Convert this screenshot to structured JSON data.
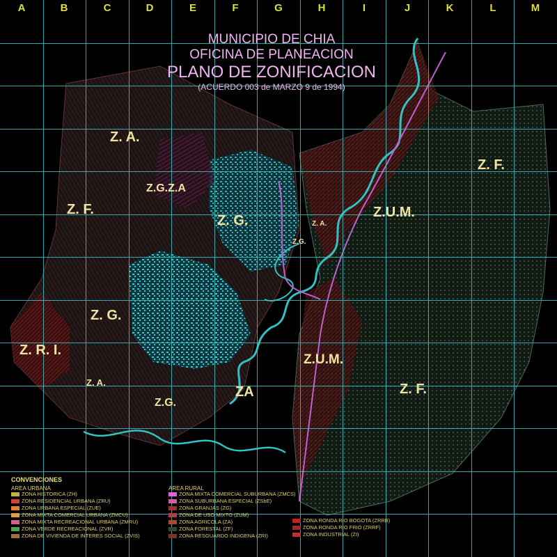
{
  "grid_columns": [
    "A",
    "B",
    "C",
    "D",
    "E",
    "F",
    "G",
    "H",
    "I",
    "J",
    "K",
    "L",
    "M"
  ],
  "title": {
    "line1": "MUNICIPIO DE CHIA",
    "line2": "OFICINA DE PLANEACION",
    "line3": "PLANO DE ZONIFICACION",
    "line4": "(ACUERDO 003 de MARZO 9 de 1994)"
  },
  "zone_labels": [
    {
      "key": "za_top",
      "text": "Z. A."
    },
    {
      "key": "zf_left",
      "text": "Z. F."
    },
    {
      "key": "zgza",
      "text": "Z.G.Z.A"
    },
    {
      "key": "zg_center",
      "text": "Z. G."
    },
    {
      "key": "zg_left",
      "text": "Z. G."
    },
    {
      "key": "zri",
      "text": "Z. R. I."
    },
    {
      "key": "za_small",
      "text": "Z. A."
    },
    {
      "key": "zg_bottom",
      "text": "Z.G."
    },
    {
      "key": "za_bottom",
      "text": "ZA"
    },
    {
      "key": "zum_top",
      "text": "Z.U.M."
    },
    {
      "key": "zum_bottom",
      "text": "Z.U.M."
    },
    {
      "key": "zf_right_top",
      "text": "Z. F."
    },
    {
      "key": "zf_right_bottom",
      "text": "Z. F."
    },
    {
      "key": "za_mid",
      "text": "Z. A."
    },
    {
      "key": "zg_small",
      "text": "Z.G."
    }
  ],
  "colors": {
    "grid": "#3fc3c8",
    "title": "#f0b4f0",
    "labels": "#f0e4a0",
    "urban_cyan": "#35d4e0",
    "river": "#2ec4c4",
    "rural_red": "#8a2a2a"
  },
  "legend": {
    "heading": "CONVENCIONES",
    "urban_title": "AREA URBANA",
    "rural_title": "AREA RURAL",
    "urban_items": [
      {
        "label": "ZONA HISTORICA (ZH)",
        "color": "#c8b040"
      },
      {
        "label": "ZONA RESIDENCIAL URBANA (ZRU)",
        "color": "#d04040"
      },
      {
        "label": "ZONA URBANA ESPECIAL (ZUE)",
        "color": "#e08030"
      },
      {
        "label": "ZONA MIXTA COMERCIAL URBANA (ZMCU)",
        "color": "#e0a040"
      },
      {
        "label": "ZONA MIXTA RECREACIONAL URBANA (ZMRU)",
        "color": "#d06090"
      },
      {
        "label": "ZONA VERDE RECREACIONAL (ZVR)",
        "color": "#50a050"
      },
      {
        "label": "ZONA DE VIVIENDA DE INTERES SOCIAL (ZVIS)",
        "color": "#a07040"
      }
    ],
    "rural_items": [
      {
        "label": "ZONA MIXTA COMERCIAL SUBURBANA (ZMCS)",
        "color": "#e060e0"
      },
      {
        "label": "ZONA SUBURBANA ESPECIAL (ZSbE)",
        "color": "#d060a0"
      },
      {
        "label": "ZONA GRANJAS (ZG)",
        "color": "#a03030"
      },
      {
        "label": "ZONA DE USO MIXTO (ZUM)",
        "color": "#b04040"
      },
      {
        "label": "ZONA AGRICOLA (ZA)",
        "color": "#b04828"
      },
      {
        "label": "ZONA FORESTAL (ZF)",
        "color": "#304830"
      },
      {
        "label": "ZONA RESGUARDO INDIGENA (ZRI)",
        "color": "#803030"
      }
    ],
    "ronda_items": [
      {
        "label": "ZONA RONDA RIO BOGOTA (ZRRB)",
        "color": "#c02020"
      },
      {
        "label": "ZONA RONDA RIO FRIO (ZRRF)",
        "color": "#a02828"
      },
      {
        "label": "ZONA INDUSTRIAL (ZI)",
        "color": "#c03030"
      }
    ]
  }
}
